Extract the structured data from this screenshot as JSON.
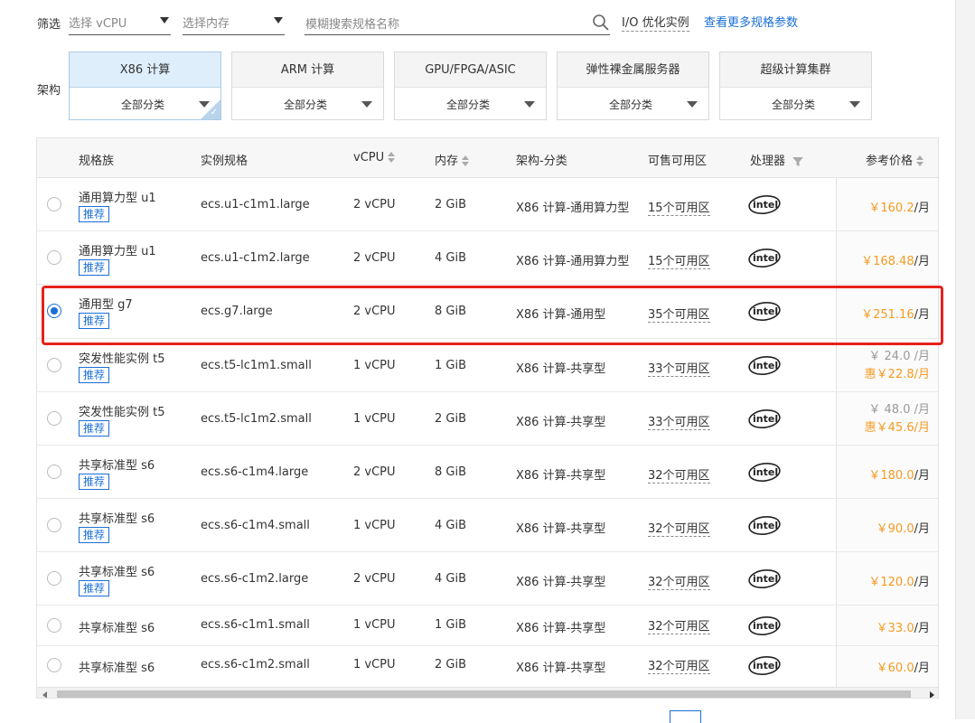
{
  "filter": {
    "label": "筛选",
    "vcpu_placeholder": "选择 vCPU",
    "memory_placeholder": "选择内存",
    "search_placeholder": "模糊搜索规格名称",
    "io_optimized": "I/O 优化实例",
    "more_params_link": "查看更多规格参数"
  },
  "arch": {
    "label": "架构",
    "cards": [
      {
        "title": "X86 计算",
        "sub": "全部分类",
        "active": true
      },
      {
        "title": "ARM 计算",
        "sub": "全部分类",
        "active": false
      },
      {
        "title": "GPU/FPGA/ASIC",
        "sub": "全部分类",
        "active": false
      },
      {
        "title": "弹性裸金属服务器",
        "sub": "全部分类",
        "active": false
      },
      {
        "title": "超级计算集群",
        "sub": "全部分类",
        "active": false
      }
    ]
  },
  "table": {
    "headers": {
      "family": "规格族",
      "spec": "实例规格",
      "vcpu": "vCPU",
      "memory": "内存",
      "arch": "架构-分类",
      "zones": "可售可用区",
      "processor": "处理器",
      "price": "参考价格"
    },
    "recommend_label": "推荐",
    "processor_logo": "intel",
    "rows": [
      {
        "family": "通用算力型 u1",
        "recommended": true,
        "spec": "ecs.u1-c1m1.large",
        "vcpu": "2 vCPU",
        "memory": "2 GiB",
        "arch": "X86 计算-通用算力型",
        "zones": "15个可用区",
        "price": "￥160.2",
        "unit": "/月",
        "selected": false
      },
      {
        "family": "通用算力型 u1",
        "recommended": true,
        "spec": "ecs.u1-c1m2.large",
        "vcpu": "2 vCPU",
        "memory": "4 GiB",
        "arch": "X86 计算-通用算力型",
        "zones": "15个可用区",
        "price": "￥168.48",
        "unit": "/月",
        "selected": false
      },
      {
        "family": "通用型 g7",
        "recommended": true,
        "spec": "ecs.g7.large",
        "vcpu": "2 vCPU",
        "memory": "8 GiB",
        "arch": "X86 计算-通用型",
        "zones": "35个可用区",
        "price": "￥251.16",
        "unit": "/月",
        "selected": true
      },
      {
        "family": "突发性能实例 t5",
        "recommended": true,
        "spec": "ecs.t5-lc1m1.small",
        "vcpu": "1 vCPU",
        "memory": "1 GiB",
        "arch": "X86 计算-共享型",
        "zones": "33个可用区",
        "price_old": "￥ 24.0 /月",
        "price_discount": "惠￥22.8/月",
        "selected": false
      },
      {
        "family": "突发性能实例 t5",
        "recommended": true,
        "spec": "ecs.t5-lc1m2.small",
        "vcpu": "1 vCPU",
        "memory": "2 GiB",
        "arch": "X86 计算-共享型",
        "zones": "33个可用区",
        "price_old": "￥ 48.0 /月",
        "price_discount": "惠￥45.6/月",
        "selected": false
      },
      {
        "family": "共享标准型 s6",
        "recommended": true,
        "spec": "ecs.s6-c1m4.large",
        "vcpu": "2 vCPU",
        "memory": "8 GiB",
        "arch": "X86 计算-共享型",
        "zones": "32个可用区",
        "price": "￥180.0",
        "unit": "/月",
        "selected": false
      },
      {
        "family": "共享标准型 s6",
        "recommended": true,
        "spec": "ecs.s6-c1m4.small",
        "vcpu": "1 vCPU",
        "memory": "4 GiB",
        "arch": "X86 计算-共享型",
        "zones": "32个可用区",
        "price": "￥90.0",
        "unit": "/月",
        "selected": false
      },
      {
        "family": "共享标准型 s6",
        "recommended": true,
        "spec": "ecs.s6-c1m2.large",
        "vcpu": "2 vCPU",
        "memory": "4 GiB",
        "arch": "X86 计算-共享型",
        "zones": "32个可用区",
        "price": "￥120.0",
        "unit": "/月",
        "selected": false
      },
      {
        "family": "共享标准型 s6",
        "recommended": false,
        "spec": "ecs.s6-c1m1.small",
        "vcpu": "1 vCPU",
        "memory": "1 GiB",
        "arch": "X86 计算-共享型",
        "zones": "32个可用区",
        "price": "￥33.0",
        "unit": "/月",
        "selected": false
      },
      {
        "family": "共享标准型 s6",
        "recommended": false,
        "spec": "ecs.s6-c1m2.small",
        "vcpu": "1 vCPU",
        "memory": "2 GiB",
        "arch": "X86 计算-共享型",
        "zones": "32个可用区",
        "price": "￥60.0",
        "unit": "/月",
        "selected": false
      }
    ]
  },
  "colors": {
    "accent": "#1a6fd6",
    "price": "#f59a23",
    "highlight": "#e5231c"
  }
}
